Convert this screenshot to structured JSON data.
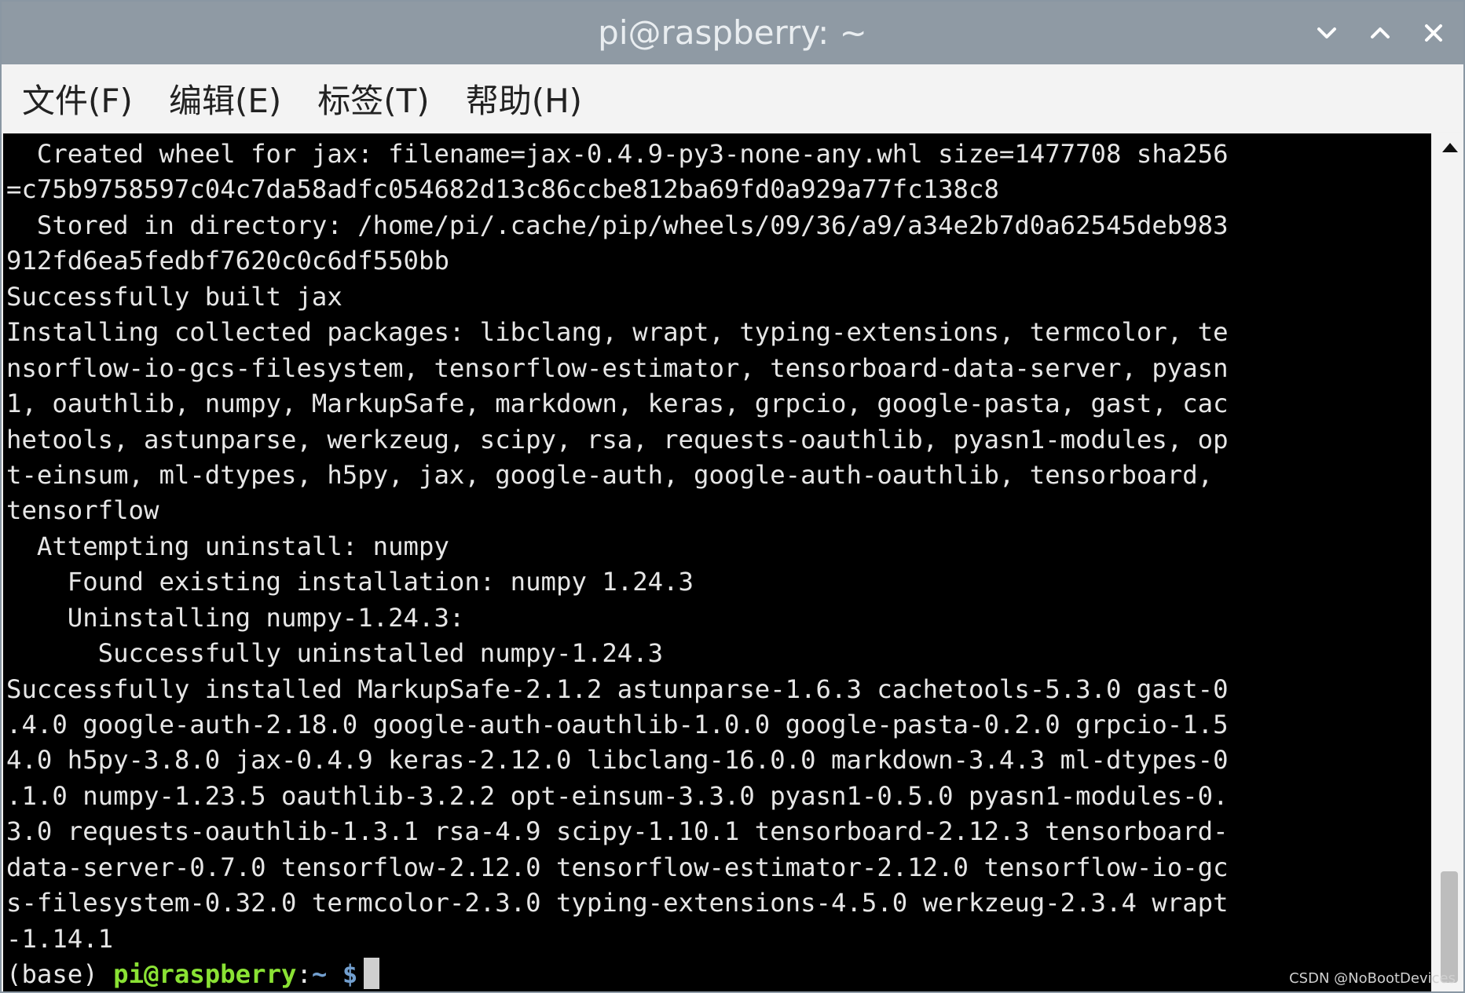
{
  "window": {
    "title": "pi@raspberry: ~"
  },
  "menu": {
    "items": [
      {
        "label": "文件(F)"
      },
      {
        "label": "编辑(E)"
      },
      {
        "label": "标签(T)"
      },
      {
        "label": "帮助(H)"
      }
    ]
  },
  "terminal": {
    "lines": [
      "  Created wheel for jax: filename=jax-0.4.9-py3-none-any.whl size=1477708 sha256",
      "=c75b9758597c04c7da58adfc054682d13c86ccbe812ba69fd0a929a77fc138c8",
      "  Stored in directory: /home/pi/.cache/pip/wheels/09/36/a9/a34e2b7d0a62545deb983",
      "912fd6ea5fedbf7620c0c6df550bb",
      "Successfully built jax",
      "Installing collected packages: libclang, wrapt, typing-extensions, termcolor, te",
      "nsorflow-io-gcs-filesystem, tensorflow-estimator, tensorboard-data-server, pyasn",
      "1, oauthlib, numpy, MarkupSafe, markdown, keras, grpcio, google-pasta, gast, cac",
      "hetools, astunparse, werkzeug, scipy, rsa, requests-oauthlib, pyasn1-modules, op",
      "t-einsum, ml-dtypes, h5py, jax, google-auth, google-auth-oauthlib, tensorboard, ",
      "tensorflow",
      "  Attempting uninstall: numpy",
      "    Found existing installation: numpy 1.24.3",
      "    Uninstalling numpy-1.24.3:",
      "      Successfully uninstalled numpy-1.24.3",
      "Successfully installed MarkupSafe-2.1.2 astunparse-1.6.3 cachetools-5.3.0 gast-0",
      ".4.0 google-auth-2.18.0 google-auth-oauthlib-1.0.0 google-pasta-0.2.0 grpcio-1.5",
      "4.0 h5py-3.8.0 jax-0.4.9 keras-2.12.0 libclang-16.0.0 markdown-3.4.3 ml-dtypes-0",
      ".1.0 numpy-1.23.5 oauthlib-3.2.2 opt-einsum-3.3.0 pyasn1-0.5.0 pyasn1-modules-0.",
      "3.0 requests-oauthlib-1.3.1 rsa-4.9 scipy-1.10.1 tensorboard-2.12.3 tensorboard-",
      "data-server-0.7.0 tensorflow-2.12.0 tensorflow-estimator-2.12.0 tensorflow-io-gc",
      "s-filesystem-0.32.0 termcolor-2.3.0 typing-extensions-4.5.0 werkzeug-2.3.4 wrapt",
      "-1.14.1"
    ],
    "prompt": {
      "env": "(base) ",
      "user_host": "pi@raspberry",
      "colon": ":",
      "path": "~",
      "symbol": " $"
    }
  },
  "watermark": "CSDN @NoBootDevices",
  "colors": {
    "titlebar": "#8f9aa4",
    "terminal_bg": "#000000",
    "terminal_fg": "#e6e6e6",
    "prompt_user": "#8ae234",
    "prompt_path": "#729fcf"
  },
  "icons": {
    "minimize": "chevron-down-icon",
    "maximize": "chevron-up-icon",
    "close": "close-icon",
    "scroll_up": "scroll-up-arrow-icon"
  }
}
